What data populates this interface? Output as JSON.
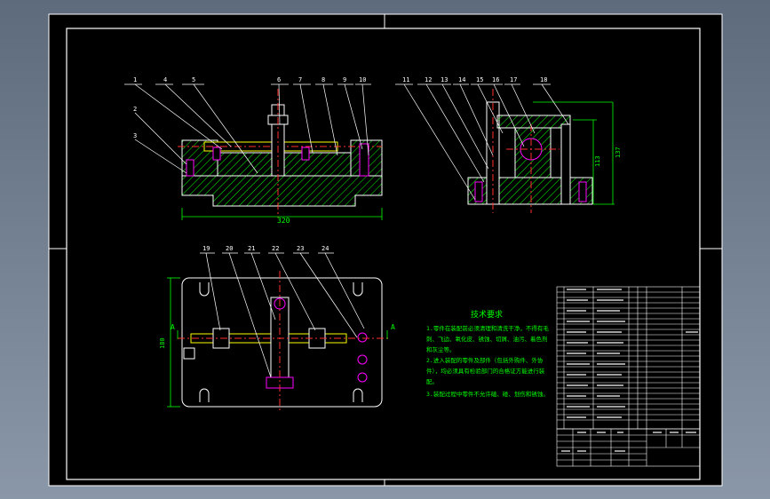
{
  "drawing": {
    "balloons_front": [
      "1",
      "2",
      "3",
      "4",
      "5",
      "6",
      "7",
      "8",
      "9",
      "10"
    ],
    "balloons_side": [
      "11",
      "12",
      "13",
      "14",
      "15",
      "16",
      "17",
      "18"
    ],
    "balloons_top": [
      "19",
      "20",
      "21",
      "22",
      "23",
      "24"
    ],
    "dim_front_width": "320",
    "dim_side_height_outer": "137",
    "dim_side_height_inner": "113",
    "dim_top_height": "180",
    "section_marks": [
      "A",
      "A"
    ]
  },
  "technical_requirements": {
    "title": "技术要求",
    "lines": [
      "1.零件在装配前必须清理和清洗干净，不得有毛",
      "刺、飞边、氧化皮、锈蚀、切屑、油污、着色剂",
      "和灰尘等。",
      "2.进入装配的零件及部件（包括外购件、外协",
      "件），均必须具有检验部门的合格证方能进行装",
      "配。",
      "3.装配过程中零件不允许磕、碰、划伤和锈蚀。"
    ]
  },
  "colors": {
    "background": "#000000",
    "frame": "#ffffff",
    "outline": "#ffffff",
    "hatch": "#00ff00",
    "centerline": "#ff3030",
    "dimension": "#00ff00",
    "yellow": "#ffff00",
    "magenta": "#ff00ff",
    "cyan": "#00ffff",
    "text": "#00ff00"
  }
}
